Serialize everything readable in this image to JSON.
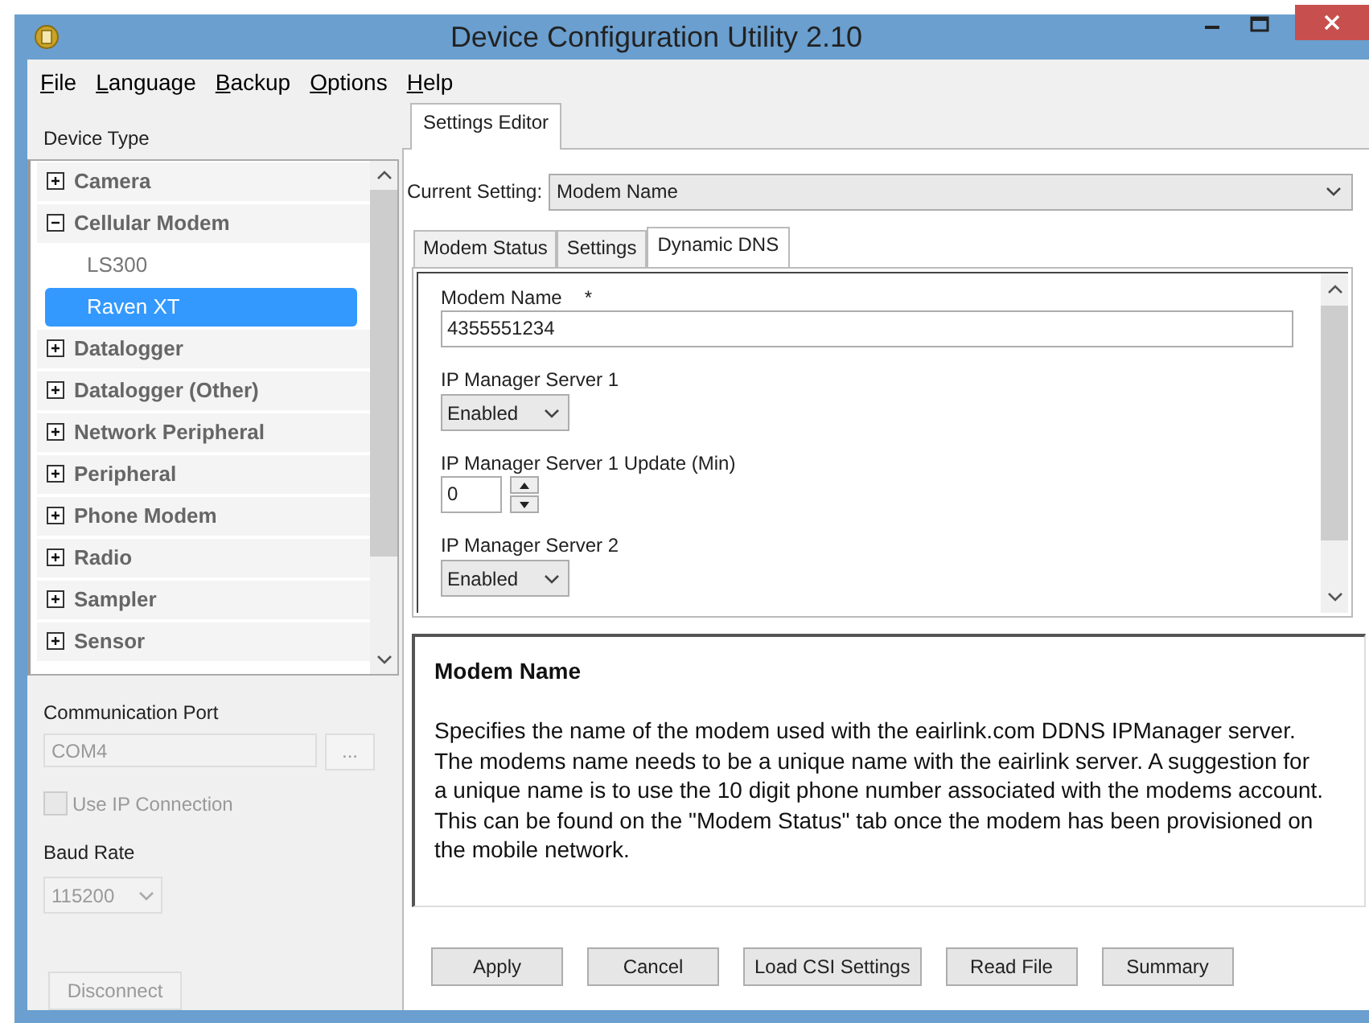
{
  "window": {
    "title": "Device Configuration Utility 2.10"
  },
  "menu": [
    "File",
    "Language",
    "Backup",
    "Options",
    "Help"
  ],
  "device_panel": {
    "label": "Device Type",
    "tree": [
      {
        "label": "Camera",
        "expanded": false,
        "selected": false
      },
      {
        "label": "Cellular Modem",
        "expanded": true,
        "selected": false,
        "children": [
          {
            "label": "LS300",
            "selected": false
          },
          {
            "label": "Raven XT",
            "selected": true
          }
        ]
      },
      {
        "label": "Datalogger",
        "expanded": false,
        "selected": false
      },
      {
        "label": "Datalogger (Other)",
        "expanded": false,
        "selected": false
      },
      {
        "label": "Network Peripheral",
        "expanded": false,
        "selected": false
      },
      {
        "label": "Peripheral",
        "expanded": false,
        "selected": false
      },
      {
        "label": "Phone Modem",
        "expanded": false,
        "selected": false
      },
      {
        "label": "Radio",
        "expanded": false,
        "selected": false
      },
      {
        "label": "Sampler",
        "expanded": false,
        "selected": false
      },
      {
        "label": "Sensor",
        "expanded": false,
        "selected": false
      }
    ]
  },
  "communication_port": {
    "label": "Communication Port",
    "value": "COM4",
    "browse_button": "...",
    "disabled": true
  },
  "use_ip_connection": {
    "label": "Use IP Connection",
    "checked": false,
    "disabled": true
  },
  "baud_rate": {
    "label": "Baud Rate",
    "value": "115200",
    "disabled": true
  },
  "disconnect_button": {
    "label": "Disconnect",
    "disabled": true
  },
  "editor_tabs": [
    {
      "label": "Settings Editor",
      "selected": true
    }
  ],
  "current_setting": {
    "label": "Current Setting:",
    "value": "Modem Name"
  },
  "setting_tabs": [
    {
      "label": "Modem Status",
      "selected": false
    },
    {
      "label": "Settings",
      "selected": false
    },
    {
      "label": "Dynamic DNS",
      "selected": true
    }
  ],
  "fields": [
    {
      "kind": "text",
      "label": "Modem Name",
      "required_mark": "*",
      "value": "4355551234"
    },
    {
      "kind": "dropdown",
      "label": "IP Manager Server 1",
      "value": "Enabled"
    },
    {
      "kind": "spinner",
      "label": "IP Manager Server 1 Update (Min)",
      "value": "0"
    },
    {
      "kind": "dropdown",
      "label": "IP Manager Server 2",
      "value": "Enabled"
    }
  ],
  "description": {
    "title": "Modem Name",
    "text": "Specifies the name of the modem used with the eairlink.com DDNS IPManager server. The modems name needs to be a unique name with the eairlink server. A suggestion for a unique name is to use the 10 digit phone number associated with the modems account. This can be found on the \"Modem Status\" tab once the modem has been provisioned on the mobile network."
  },
  "buttons": [
    "Apply",
    "Cancel",
    "Load CSI Settings",
    "Read File",
    "Summary"
  ]
}
